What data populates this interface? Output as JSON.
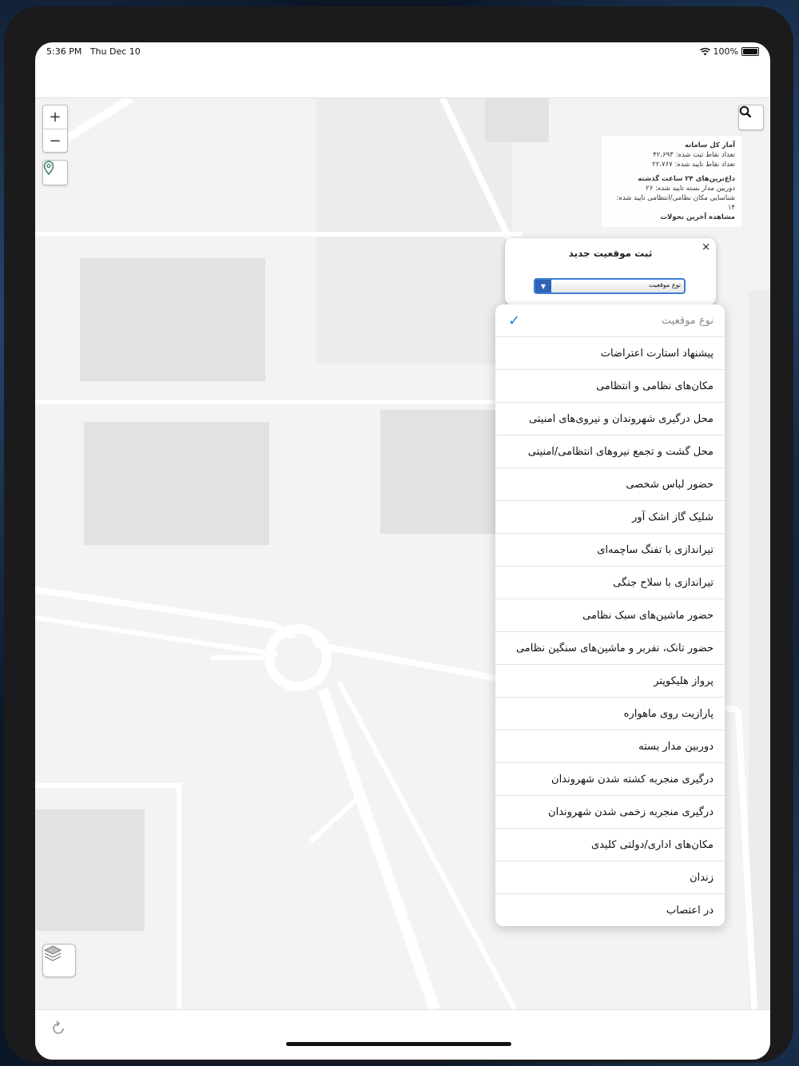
{
  "status_bar": {
    "time": "5:36 PM",
    "date": "Thu Dec 10",
    "battery": "100%",
    "wifi_icon": "wifi-icon",
    "battery_icon": "battery-icon"
  },
  "map_controls": {
    "zoom_in": "+",
    "zoom_out": "−",
    "location_icon": "map-pin-icon",
    "search_icon": "search-icon",
    "layers_icon": "layers-icon",
    "refresh_icon": "refresh-icon"
  },
  "stats": {
    "title": "آمار کل سامانه",
    "registered": "تعداد نقاط ثبت شده: ۴۲،۶۹۳",
    "confirmed": "تعداد نقاط تایید شده: ۲۲،۷۶۷",
    "hot_title": "داغ‌ترین‌های ۲۴ ساعت گذشته",
    "cctv": "دوربین مدار بسته تایید شده: ۲۶",
    "military": "شناسایی مکان نظامی/انتظامی تایید شده:",
    "military_count": "۱۴",
    "latest": "مشاهده آخرین تحولات"
  },
  "popup": {
    "title": "ثبت موقعیت جدید",
    "close": "×",
    "select_value": "نوع موقعیت"
  },
  "dropdown": {
    "selected_index": 0,
    "options": [
      "نوع موقعیت",
      "پیشنهاد استارت اعتراضات",
      "مکان‌های نظامی و انتظامی",
      "محل درگیری شهروندان و نیروی‌های امنیتی",
      "محل گشت و تجمع نیروهای انتظامی/امنیتی",
      "حضور لباس شخصی",
      "شلیک گاز اشک آور",
      "تیراندازی با تفنگ ساچمه‌ای",
      "تیراندازی با سلاح جنگی",
      "حضور ماشین‌های سبک نظامی",
      "حضور تانک، نفربر و ماشین‌های سنگین نظامی",
      "پرواز هلیکوپتر",
      "پارازیت روی ماهواره",
      "دوربین مدار بسته",
      "درگیری منجربه کشته شدن شهروندان",
      "درگیری منجربه زخمی شدن شهروندان",
      "مکان‌های اداری/دولتی کلیدی",
      "زندان",
      "در اعتصاب"
    ]
  }
}
